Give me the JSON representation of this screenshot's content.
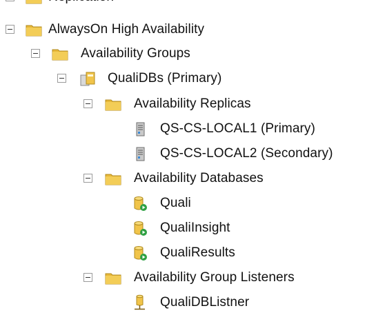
{
  "tree": {
    "partial_top": {
      "label": "Replication"
    },
    "always_on": {
      "label": "AlwaysOn High Availability"
    },
    "availability_groups": {
      "label": "Availability Groups"
    },
    "group": {
      "label": "QualiDBs (Primary)"
    },
    "replicas": {
      "label": "Availability Replicas",
      "items": [
        {
          "label": "QS-CS-LOCAL1 (Primary)"
        },
        {
          "label": "QS-CS-LOCAL2 (Secondary)"
        }
      ]
    },
    "databases": {
      "label": "Availability Databases",
      "items": [
        {
          "label": "Quali"
        },
        {
          "label": "QualiInsight"
        },
        {
          "label": "QualiResults"
        }
      ]
    },
    "listeners": {
      "label": "Availability Group Listeners",
      "items": [
        {
          "label": "QualiDBListner"
        }
      ]
    }
  },
  "icons": {
    "folder": "folder-icon",
    "availability_group": "availability-group-icon",
    "server": "server-icon",
    "database": "database-icon",
    "listener": "listener-icon"
  },
  "colors": {
    "folder_yellow": "#e8b83a",
    "db_green": "#2ea043"
  }
}
